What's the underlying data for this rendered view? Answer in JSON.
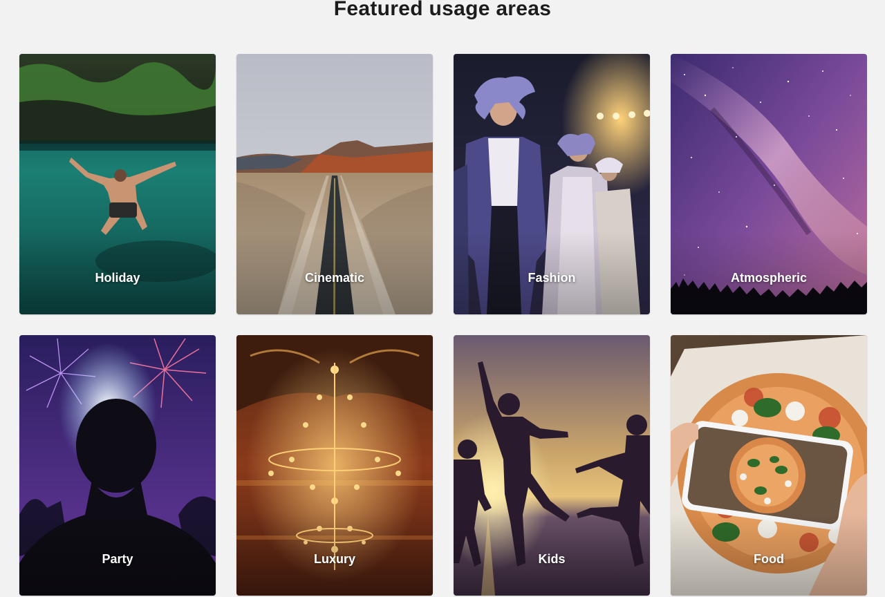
{
  "section": {
    "title": "Featured usage areas"
  },
  "cards": [
    {
      "label": "Holiday"
    },
    {
      "label": "Cinematic"
    },
    {
      "label": "Fashion"
    },
    {
      "label": "Atmospheric"
    },
    {
      "label": "Party"
    },
    {
      "label": "Luxury"
    },
    {
      "label": "Kids"
    },
    {
      "label": "Food"
    }
  ],
  "colors": {
    "background": "#f2f2f2",
    "title": "#1c1c1c",
    "label": "#ffffff"
  }
}
